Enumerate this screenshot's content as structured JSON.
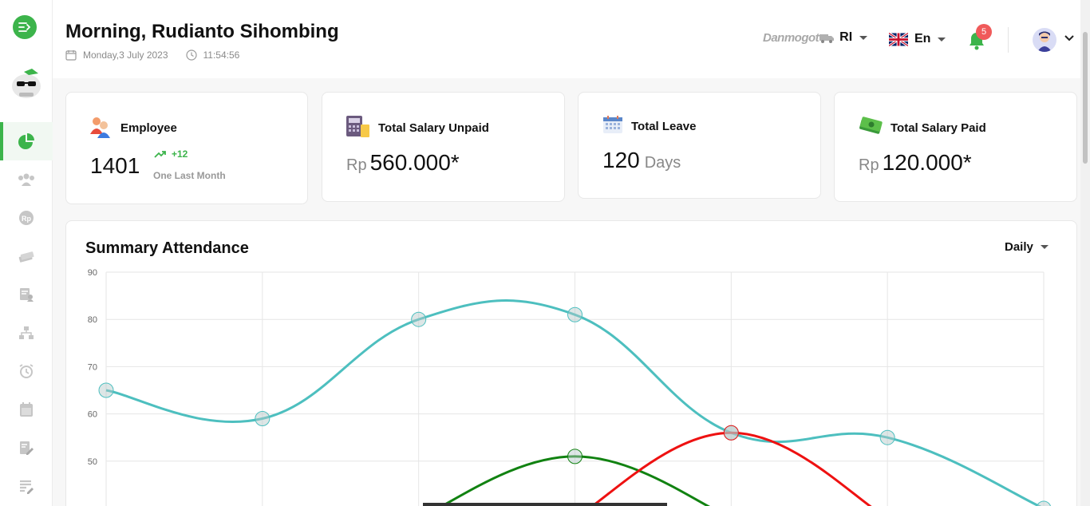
{
  "header": {
    "greeting": "Morning, Rudianto Sihombing",
    "date": "Monday,3 July 2023",
    "time": "11:54:56",
    "company_logo_text": "Danmogot",
    "company_code": "RI",
    "language": "En",
    "notification_count": "5"
  },
  "sidebar": {
    "items": [
      {
        "icon": "dashboard-pie-icon",
        "active": true
      },
      {
        "icon": "employees-icon"
      },
      {
        "icon": "payroll-rp-icon"
      },
      {
        "icon": "money-icon"
      },
      {
        "icon": "user-report-icon"
      },
      {
        "icon": "org-structure-icon"
      },
      {
        "icon": "alarm-icon"
      },
      {
        "icon": "calendar-icon"
      },
      {
        "icon": "edit-document-icon"
      },
      {
        "icon": "edit-list-icon"
      }
    ]
  },
  "cards": {
    "employee": {
      "title": "Employee",
      "value": "1401",
      "trend": "+12",
      "trend_label": "One Last Month"
    },
    "salary_unpaid": {
      "title": "Total Salary Unpaid",
      "prefix": "Rp",
      "value": "560.000*"
    },
    "leave": {
      "title": "Total Leave",
      "value": "120",
      "suffix": "Days"
    },
    "salary_paid": {
      "title": "Total Salary Paid",
      "prefix": "Rp",
      "value": "120.000*"
    }
  },
  "attendance": {
    "title": "Summary Attendance",
    "period": "Daily"
  },
  "colors": {
    "accent": "#3cb44b",
    "teal": "#4dbfbf",
    "green": "#118211",
    "red": "#ee1111",
    "badge": "#f05a5a"
  },
  "chart_data": {
    "type": "line",
    "x": [
      0,
      1,
      2,
      3,
      4,
      5,
      6
    ],
    "ylim": [
      40,
      90
    ],
    "yticks": [
      90,
      80,
      70,
      60,
      50
    ],
    "grid": true,
    "series": [
      {
        "color": "#4dbfbf",
        "values": [
          65,
          59,
          80,
          81,
          56,
          55,
          40
        ]
      },
      {
        "color": "#118211",
        "values": [
          null,
          null,
          38,
          51,
          38,
          null,
          null
        ]
      },
      {
        "color": "#ee1111",
        "values": [
          null,
          null,
          null,
          38,
          56,
          38,
          null
        ]
      }
    ]
  }
}
